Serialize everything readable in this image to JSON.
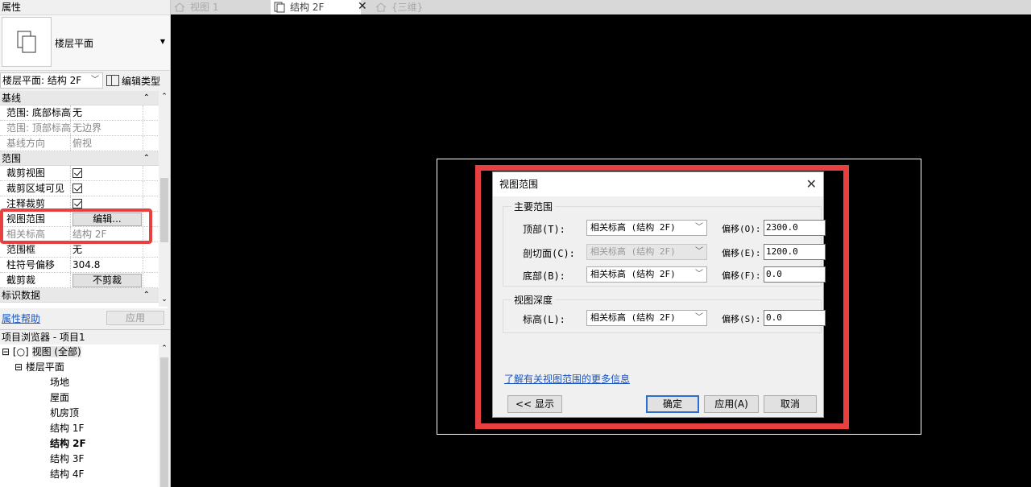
{
  "properties_panel": {
    "title": "属性",
    "type_name": "楼层平面",
    "view_selector": "楼层平面: 结构 2F",
    "edit_type_label": "编辑类型",
    "sections": [
      {
        "label": "基线",
        "rows": [
          {
            "key": "范围: 底部标高",
            "value": "无",
            "gray": false
          },
          {
            "key": "范围: 顶部标高",
            "value": "无边界",
            "gray": true
          },
          {
            "key": "基线方向",
            "value": "俯视",
            "gray": true
          }
        ]
      },
      {
        "label": "范围",
        "rows": [
          {
            "key": "裁剪视图",
            "checkbox": true
          },
          {
            "key": "裁剪区域可见",
            "checkbox": true
          },
          {
            "key": "注释裁剪",
            "checkbox": false
          },
          {
            "key": "视图范围",
            "button": "编辑..."
          },
          {
            "key": "相关标高",
            "value": "结构 2F",
            "gray": true
          },
          {
            "key": "范围框",
            "value": "无",
            "gray": false
          },
          {
            "key": "柱符号偏移",
            "value": "304.8",
            "gray": false
          },
          {
            "key": "截剪裁",
            "button": "不剪裁"
          }
        ]
      },
      {
        "label": "标识数据",
        "rows": []
      }
    ],
    "help_link": "属性帮助",
    "apply_button": "应用"
  },
  "project_browser": {
    "title": "项目浏览器 - 项目1",
    "root": "视图 (全部)",
    "group": "楼层平面",
    "items": [
      "场地",
      "屋面",
      "机房顶",
      "结构 1F",
      "结构 2F",
      "结构 3F",
      "结构 4F"
    ],
    "active_item": "结构 2F"
  },
  "tabs": [
    {
      "label": "视图 1",
      "active": false
    },
    {
      "label": "结构 2F",
      "active": true
    },
    {
      "label": "{三维}",
      "active": false
    }
  ],
  "dialog": {
    "title": "视图范围",
    "primary_group": "主要范围",
    "rows": [
      {
        "label": "顶部(T):",
        "level": "相关标高 (结构 2F)",
        "offset_label": "偏移(O):",
        "offset": "2300.0",
        "disabled": false
      },
      {
        "label": "剖切面(C):",
        "level": "相关标高 (结构 2F)",
        "offset_label": "偏移(E):",
        "offset": "1200.0",
        "disabled": true
      },
      {
        "label": "底部(B):",
        "level": "相关标高 (结构 2F)",
        "offset_label": "偏移(F):",
        "offset": "0.0",
        "disabled": false
      }
    ],
    "depth_group": "视图深度",
    "depth_row": {
      "label": "标高(L):",
      "level": "相关标高 (结构 2F)",
      "offset_label": "偏移(S):",
      "offset": "0.0"
    },
    "more_info_link": "了解有关视图范围的更多信息",
    "buttons": {
      "show": "<< 显示",
      "ok": "确定",
      "apply": "应用(A)",
      "cancel": "取消"
    }
  },
  "colors": {
    "highlight": "#e8403f",
    "link": "#1a55c4",
    "canvas": "#000000"
  }
}
